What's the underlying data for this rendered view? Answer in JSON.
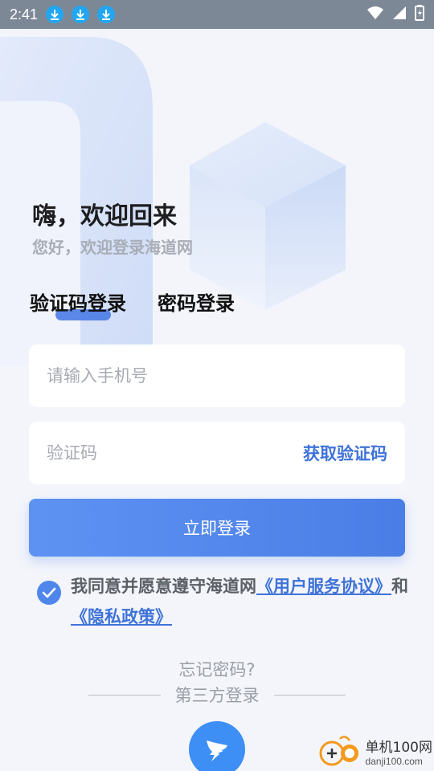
{
  "status_bar": {
    "time": "2:41",
    "icons": [
      "download-icon",
      "download-icon",
      "download-icon",
      "wifi-icon",
      "signal-icon",
      "battery-icon"
    ]
  },
  "greeting": {
    "title": "嗨，欢迎回来",
    "subtitle": "您好，欢迎登录海道网"
  },
  "tabs": [
    {
      "label": "验证码登录",
      "active": true
    },
    {
      "label": "密码登录",
      "active": false
    }
  ],
  "phone_input": {
    "placeholder": "请输入手机号",
    "value": ""
  },
  "code_input": {
    "placeholder": "验证码",
    "value": ""
  },
  "get_code_label": "获取验证码",
  "login_button": "立即登录",
  "agreement": {
    "checked": true,
    "prefix": "我同意并愿意遵守海道网",
    "terms_link": "《用户服务协议》",
    "and": "和",
    "privacy_link": "《隐私政策》"
  },
  "forgot_password": "忘记密码?",
  "third_party_label": "第三方登录",
  "third_party_icons": [
    "dingtalk-icon"
  ],
  "watermark": {
    "cn": "单机100网",
    "url": "danji100.com"
  },
  "colors": {
    "accent": "#4a7ee6",
    "link": "#3f73d8",
    "background": "#f3f5fb"
  }
}
